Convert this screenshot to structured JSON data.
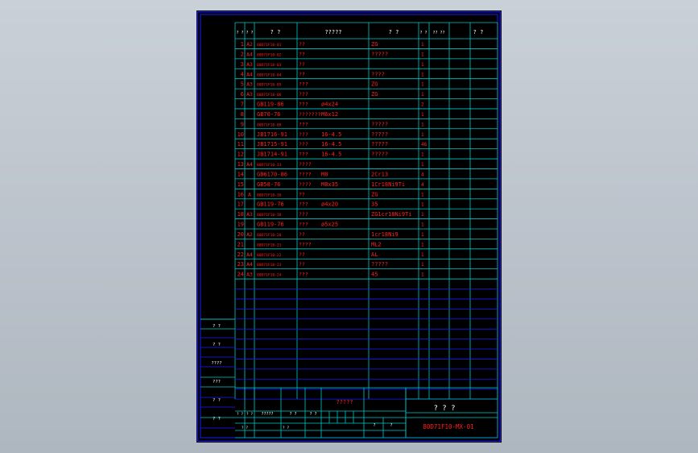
{
  "colors": {
    "background": "#000000",
    "frame": "#1a1aff",
    "grid": "#00c8c8",
    "text_red": "#ff2020",
    "text_white": "#ffffff"
  },
  "header": {
    "c0": "? ?",
    "c1": "? ?",
    "c2": "? ?",
    "c3": "?????",
    "c4": "? ?",
    "c5": "? ?",
    "c6": "?? ??",
    "c7": "? ?"
  },
  "rows": [
    {
      "no": "1",
      "size": "A2",
      "code": "80D71F10-01",
      "name": "??",
      "spec": "",
      "mat": "ZG",
      "qty": "1"
    },
    {
      "no": "2",
      "size": "A4",
      "code": "80D71F10-02",
      "name": "??",
      "spec": "",
      "mat": "?????",
      "qty": "1"
    },
    {
      "no": "3",
      "size": "A3",
      "code": "80D71F10-03",
      "name": "??",
      "spec": "",
      "mat": "",
      "qty": "1"
    },
    {
      "no": "4",
      "size": "A4",
      "code": "80D71F10-04",
      "name": "??",
      "spec": "",
      "mat": "????",
      "qty": "1"
    },
    {
      "no": "5",
      "size": "A3",
      "code": "80D71F10-05",
      "name": "???",
      "spec": "",
      "mat": "ZG",
      "qty": "1"
    },
    {
      "no": "6",
      "size": "A3",
      "code": "80D71F10-06",
      "name": "???",
      "spec": "",
      "mat": "ZG",
      "qty": "1"
    },
    {
      "no": "7",
      "size": "",
      "code": "GB119-86",
      "name": "???",
      "spec": "ø4x24",
      "mat": "",
      "qty": "2"
    },
    {
      "no": "8",
      "size": "",
      "code": "GB70-76",
      "name": "???????",
      "spec": "M6x12",
      "mat": "",
      "qty": "1"
    },
    {
      "no": "9",
      "size": "",
      "code": "80D71F10-09",
      "name": "???",
      "spec": "",
      "mat": "?????",
      "qty": "1"
    },
    {
      "no": "10",
      "size": "",
      "code": "JB1716-91",
      "name": "???",
      "spec": "16-4.5",
      "mat": "?????",
      "qty": "1"
    },
    {
      "no": "11",
      "size": "",
      "code": "JB1715-91",
      "name": "???",
      "spec": "16-4.5",
      "mat": "?????",
      "qty": "46"
    },
    {
      "no": "12",
      "size": "",
      "code": "JB1714-91",
      "name": "???",
      "spec": "16-4.5",
      "mat": "?????",
      "qty": "1"
    },
    {
      "no": "13",
      "size": "A4",
      "code": "80D71F10-13",
      "name": "????",
      "spec": "",
      "mat": "",
      "qty": "1"
    },
    {
      "no": "14",
      "size": "",
      "code": "GB6170-86",
      "name": "????",
      "spec": "M8",
      "mat": "2Cr13",
      "qty": "4"
    },
    {
      "no": "15",
      "size": "",
      "code": "GB58-76",
      "name": "????",
      "spec": "M8x35",
      "mat": "1Cr18Ni9Ti",
      "qty": "4"
    },
    {
      "no": "16",
      "size": "A",
      "code": "80D71F10-16",
      "name": "??",
      "spec": "",
      "mat": "ZG",
      "qty": "1"
    },
    {
      "no": "17",
      "size": "",
      "code": "GB119-76",
      "name": "???",
      "spec": "ø4x20",
      "mat": "35",
      "qty": "1"
    },
    {
      "no": "18",
      "size": "A3",
      "code": "80D71F10-18",
      "name": "???",
      "spec": "",
      "mat": "ZG1cr18Ni9Ti",
      "qty": "1"
    },
    {
      "no": "19",
      "size": "",
      "code": "GB119-76",
      "name": "???",
      "spec": "ø5x25",
      "mat": "",
      "qty": "1"
    },
    {
      "no": "20",
      "size": "A2",
      "code": "80D71F10-20",
      "name": "??",
      "spec": "",
      "mat": "1cr18Ni9",
      "qty": "1"
    },
    {
      "no": "21",
      "size": "",
      "code": "80D71F10-21",
      "name": "????",
      "spec": "",
      "mat": "ML2",
      "qty": "1"
    },
    {
      "no": "22",
      "size": "A4",
      "code": "80D71F10-22",
      "name": "??",
      "spec": "",
      "mat": "AL",
      "qty": "1"
    },
    {
      "no": "23",
      "size": "A4",
      "code": "80D71F10-23",
      "name": "??",
      "spec": "",
      "mat": "?????",
      "qty": "1"
    },
    {
      "no": "24",
      "size": "A3",
      "code": "80D71F10-24",
      "name": "???",
      "spec": "",
      "mat": "45",
      "qty": "1"
    }
  ],
  "left_block": [
    "? ?",
    "? ?",
    "????",
    "???",
    "? ?",
    "? ?"
  ],
  "title_block": {
    "drawing_name": "?????",
    "company": "? ? ?",
    "drawing_no": "80D71F10-MX-01",
    "b1": "? ?",
    "b2": "? ?",
    "b3": "?????",
    "b4": "? ?",
    "b5": "? ?",
    "b6": "? ?",
    "b7": "? ?",
    "b8": "?",
    "b9": "?"
  }
}
